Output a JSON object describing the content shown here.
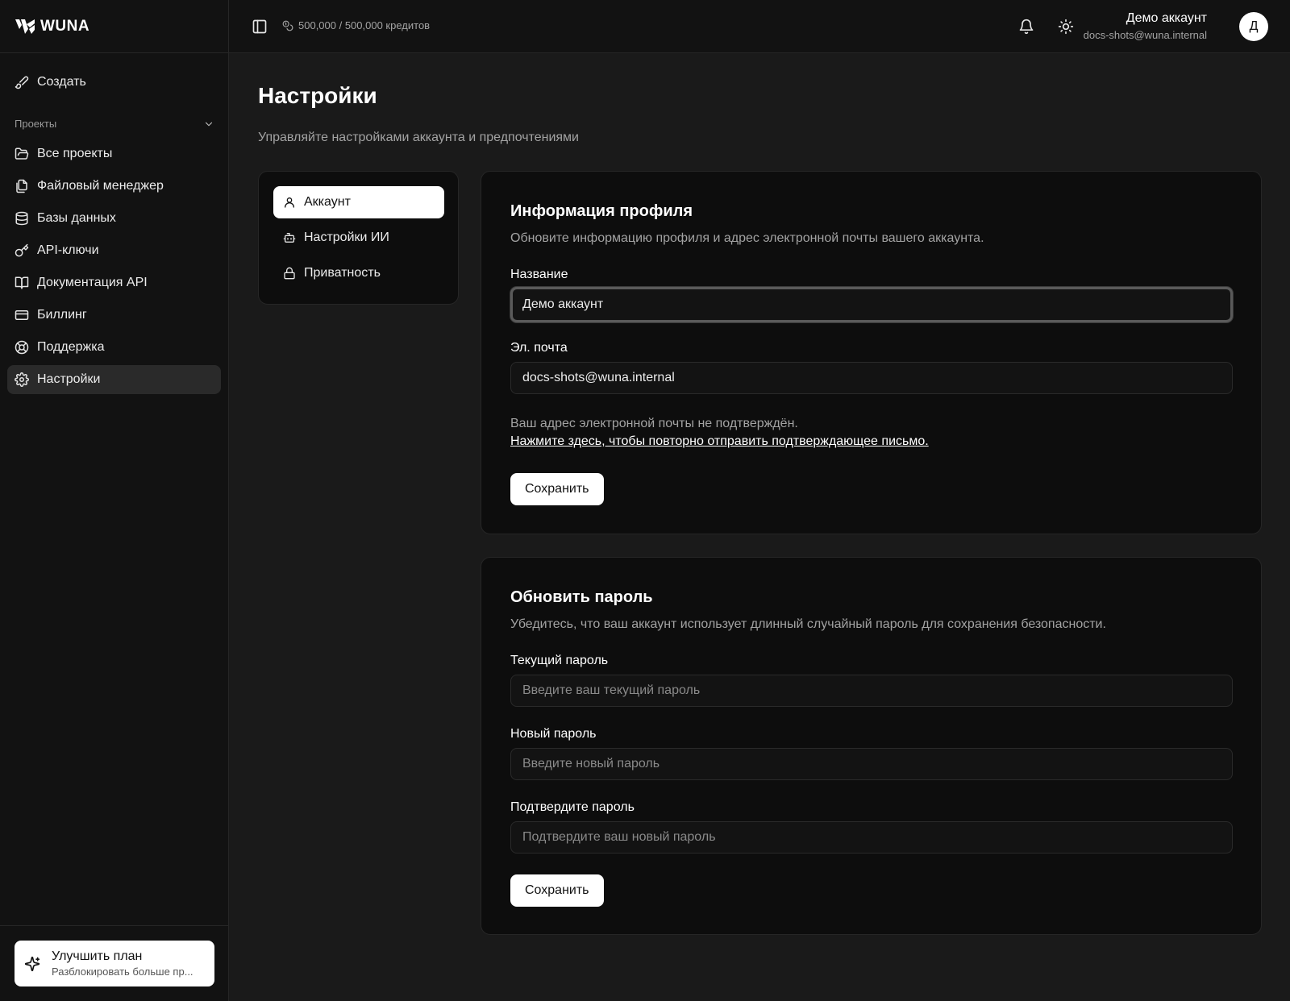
{
  "app": {
    "brand": "WUNA"
  },
  "sidebar": {
    "create_label": "Создать",
    "section_label": "Проекты",
    "items": [
      {
        "label": "Все проекты",
        "icon": "folder-open-icon"
      },
      {
        "label": "Файловый менеджер",
        "icon": "files-icon"
      },
      {
        "label": "Базы данных",
        "icon": "database-icon"
      },
      {
        "label": "API-ключи",
        "icon": "key-icon"
      },
      {
        "label": "Документация API",
        "icon": "book-open-icon"
      },
      {
        "label": "Биллинг",
        "icon": "credit-card-icon"
      },
      {
        "label": "Поддержка",
        "icon": "life-buoy-icon"
      },
      {
        "label": "Настройки",
        "icon": "gear-icon",
        "active": true
      }
    ],
    "upgrade": {
      "title": "Улучшить план",
      "subtitle": "Разблокировать больше пр..."
    }
  },
  "topbar": {
    "credits": "500,000 / 500,000 кредитов",
    "user": {
      "name": "Демо аккаунт",
      "email": "docs-shots@wuna.internal",
      "avatar_letter": "Д"
    }
  },
  "page": {
    "title": "Настройки",
    "subtitle": "Управляйте настройками аккаунта и предпочтениями"
  },
  "settings_nav": [
    {
      "label": "Аккаунт",
      "icon": "user-icon",
      "active": true
    },
    {
      "label": "Настройки ИИ",
      "icon": "bot-icon"
    },
    {
      "label": "Приватность",
      "icon": "lock-icon"
    }
  ],
  "profile": {
    "title": "Информация профиля",
    "description": "Обновите информацию профиля и адрес электронной почты вашего аккаунта.",
    "name_label": "Название",
    "name_value": "Демо аккаунт",
    "email_label": "Эл. почта",
    "email_value": "docs-shots@wuna.internal",
    "unverified_note": "Ваш адрес электронной почты не подтверждён.",
    "resend_link": "Нажмите здесь, чтобы повторно отправить подтверждающее письмо.",
    "save_label": "Сохранить"
  },
  "password": {
    "title": "Обновить пароль",
    "description": "Убедитесь, что ваш аккаунт использует длинный случайный пароль для сохранения безопасности.",
    "current_label": "Текущий пароль",
    "current_placeholder": "Введите ваш текущий пароль",
    "new_label": "Новый пароль",
    "new_placeholder": "Введите новый пароль",
    "confirm_label": "Подтвердите пароль",
    "confirm_placeholder": "Подтвердите ваш новый пароль",
    "save_label": "Сохранить"
  },
  "colors": {
    "background": "#1a1a1a",
    "sidebar": "#121212",
    "card": "#0d0d0d",
    "accent": "#ffffff"
  }
}
